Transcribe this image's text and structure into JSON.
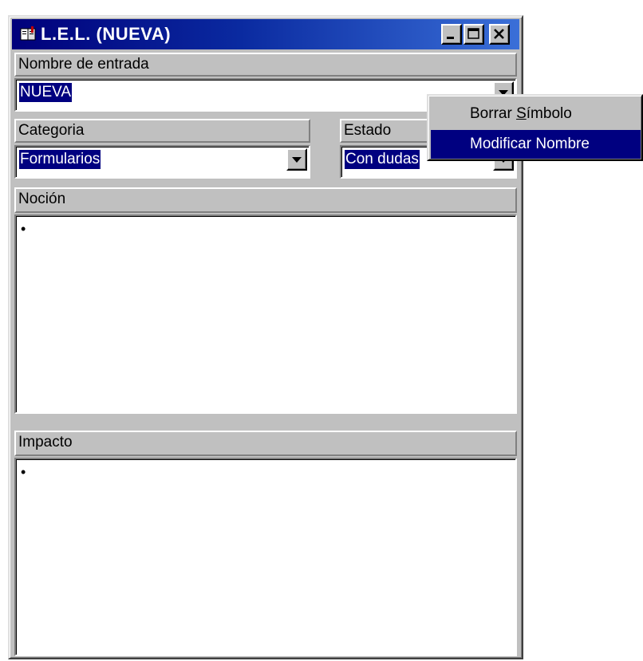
{
  "window": {
    "title": "L.E.L. (NUEVA)",
    "icon": "book-icon",
    "controls": [
      "minimize-icon",
      "maximize-icon",
      "close-icon"
    ]
  },
  "entry": {
    "label": "Nombre de entrada",
    "value": "NUEVA"
  },
  "category": {
    "label": "Categoria",
    "value": "Formularios"
  },
  "status": {
    "label": "Estado",
    "value": "Con dudas"
  },
  "notion": {
    "label": "Noción",
    "bullet": "•"
  },
  "impact": {
    "label": "Impacto",
    "bullet": "•"
  },
  "context_menu": {
    "items": [
      {
        "label_before": "Borrar ",
        "label_accel": "S",
        "label_after": "ímbolo",
        "highlighted": false
      },
      {
        "label": "Modificar Nombre",
        "highlighted": true
      }
    ]
  },
  "colors": {
    "titlebar_start": "#00007b",
    "titlebar_end": "#3a6fd8",
    "selection": "#000080",
    "face": "#c0c0c0"
  }
}
